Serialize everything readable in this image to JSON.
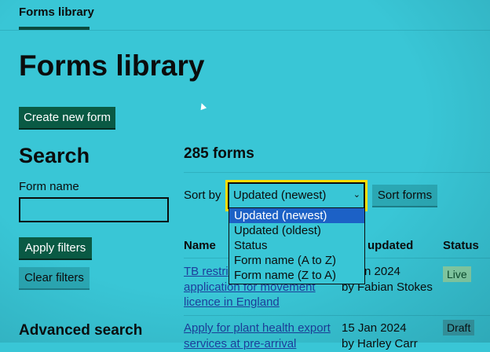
{
  "nav": {
    "item": "Forms library"
  },
  "page": {
    "title": "Forms library",
    "create_button": "Create new form"
  },
  "search": {
    "heading": "Search",
    "form_name_label": "Form name",
    "form_name_value": "",
    "apply_button": "Apply filters",
    "clear_button": "Clear filters",
    "advanced_heading": "Advanced search"
  },
  "results": {
    "count": "285 forms",
    "sort_label": "Sort by",
    "sort_selected": "Updated (newest)",
    "sort_button": "Sort forms",
    "sort_options": [
      "Updated (newest)",
      "Updated (oldest)",
      "Status",
      "Form name (A to Z)",
      "Form name (Z to A)"
    ],
    "columns": {
      "name": "Name",
      "updated": "updated",
      "status": "Status"
    },
    "rows": [
      {
        "name_line1": "TB restri",
        "name_line2": "application for movement",
        "name_line3": "licence in England",
        "date": "n 2024",
        "by": "by Fabian Stokes",
        "status": "Live"
      },
      {
        "name_line1": "Apply for plant health export",
        "name_line2": "services at pre-arrival",
        "date": "15 Jan 2024",
        "by": "by Harley Carr",
        "status": "Draft"
      }
    ]
  },
  "colors": {
    "background": "#39c6d6",
    "primary_button": "#0a5a44",
    "link": "#1d3e9c",
    "focus": "#ffdd00",
    "selected_option": "#1c61c6"
  }
}
